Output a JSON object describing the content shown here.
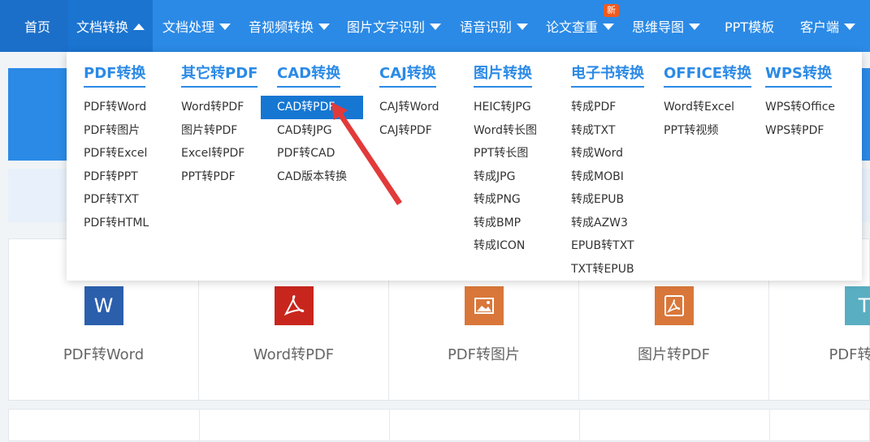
{
  "nav": {
    "items": [
      {
        "label": "首页"
      },
      {
        "label": "文档转换"
      },
      {
        "label": "文档处理"
      },
      {
        "label": "音视频转换"
      },
      {
        "label": "图片文字识别"
      },
      {
        "label": "语音识别"
      },
      {
        "label": "论文查重"
      },
      {
        "label": "思维导图"
      },
      {
        "label": "PPT模板"
      },
      {
        "label": "客户端"
      }
    ],
    "badge": "新"
  },
  "dropdown": {
    "columns": [
      {
        "title": "PDF转换",
        "links": [
          "PDF转Word",
          "PDF转图片",
          "PDF转Excel",
          "PDF转PPT",
          "PDF转TXT",
          "PDF转HTML"
        ]
      },
      {
        "title": "其它转PDF",
        "links": [
          "Word转PDF",
          "图片转PDF",
          "Excel转PDF",
          "PPT转PDF"
        ]
      },
      {
        "title": "CAD转换",
        "links": [
          "CAD转PDF",
          "CAD转JPG",
          "PDF转CAD",
          "CAD版本转换"
        ]
      },
      {
        "title": "CAJ转换",
        "links": [
          "CAJ转Word",
          "CAJ转PDF"
        ]
      },
      {
        "title": "图片转换",
        "links": [
          "HEIC转JPG",
          "Word转长图",
          "PPT转长图",
          "转成JPG",
          "转成PNG",
          "转成BMP",
          "转成ICON"
        ]
      },
      {
        "title": "电子书转换",
        "links": [
          "转成PDF",
          "转成TXT",
          "转成Word",
          "转成MOBI",
          "转成EPUB",
          "转成AZW3",
          "EPUB转TXT",
          "TXT转EPUB"
        ]
      },
      {
        "title": "OFFICE转换",
        "links": [
          "Word转Excel",
          "PPT转视频"
        ]
      },
      {
        "title": "WPS转换",
        "links": [
          "WPS转Office",
          "WPS转PDF"
        ]
      }
    ]
  },
  "cards": [
    {
      "label": "PDF转Word",
      "icon": "W",
      "color": "#2b5fac"
    },
    {
      "label": "Word转PDF",
      "icon": "pdf",
      "color": "#c8261d"
    },
    {
      "label": "PDF转图片",
      "icon": "image",
      "color": "#d9773a"
    },
    {
      "label": "图片转PDF",
      "icon": "pdf",
      "color": "#d9773a"
    },
    {
      "label": "PDF转TXT",
      "icon": "T",
      "color": "#5aaec2"
    }
  ],
  "colors": {
    "primary": "#2b8ae6",
    "selected": "#1677d2",
    "badge": "#f25a1e",
    "arrow": "#e23a3a"
  }
}
